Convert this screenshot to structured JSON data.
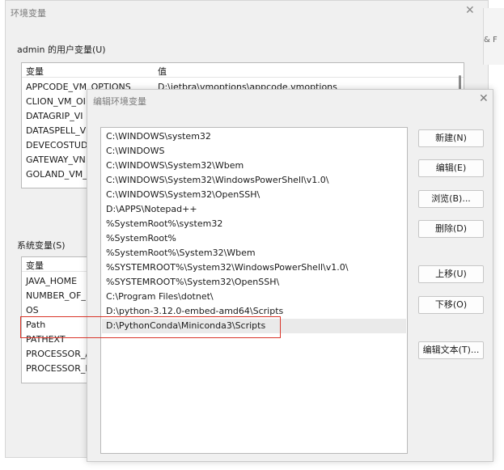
{
  "back_window": {
    "title": "环境变量",
    "user_group": {
      "label": "admin 的用户变量(U)",
      "header": {
        "name": "变量",
        "value": "值"
      },
      "rows": [
        {
          "name": "APPCODE_VM_OPTIONS",
          "value": "D:\\jetbra\\vmoptions\\appcode.vmoptions"
        },
        {
          "name": "CLION_VM_OI"
        },
        {
          "name": "DATAGRIP_VI"
        },
        {
          "name": "DATASPELL_V"
        },
        {
          "name": "DEVECOSTUD"
        },
        {
          "name": "GATEWAY_VN"
        },
        {
          "name": "GOLAND_VM_"
        }
      ]
    },
    "system_group": {
      "label": "系统变量(S)",
      "header": {
        "name": "变量"
      },
      "rows": [
        {
          "name": "JAVA_HOME"
        },
        {
          "name": "NUMBER_OF_"
        },
        {
          "name": "OS"
        },
        {
          "name": "Path"
        },
        {
          "name": "PATHEXT"
        },
        {
          "name": "PROCESSOR_/"
        },
        {
          "name": "PROCESSOR_I"
        }
      ]
    }
  },
  "right_window": {
    "partial_text": "& F"
  },
  "dialog": {
    "title": "编辑环境变量",
    "paths": [
      "C:\\WINDOWS\\system32",
      "C:\\WINDOWS",
      "C:\\WINDOWS\\System32\\Wbem",
      "C:\\WINDOWS\\System32\\WindowsPowerShell\\v1.0\\",
      "C:\\WINDOWS\\System32\\OpenSSH\\",
      "D:\\APPS\\Notepad++",
      "%SystemRoot%\\system32",
      "%SystemRoot%",
      "%SystemRoot%\\System32\\Wbem",
      "%SYSTEMROOT%\\System32\\WindowsPowerShell\\v1.0\\",
      "%SYSTEMROOT%\\System32\\OpenSSH\\",
      "C:\\Program Files\\dotnet\\",
      "D:\\python-3.12.0-embed-amd64\\Scripts",
      "D:\\PythonConda\\Miniconda3\\Scripts"
    ],
    "selected_index": 13,
    "buttons": {
      "new": "新建(N)",
      "edit": "编辑(E)",
      "browse": "浏览(B)...",
      "delete": "删除(D)",
      "move_up": "上移(U)",
      "move_down": "下移(O)",
      "edit_text": "编辑文本(T)..."
    }
  },
  "colors": {
    "highlight": "#d9362b",
    "selection": "#eaeaea"
  }
}
